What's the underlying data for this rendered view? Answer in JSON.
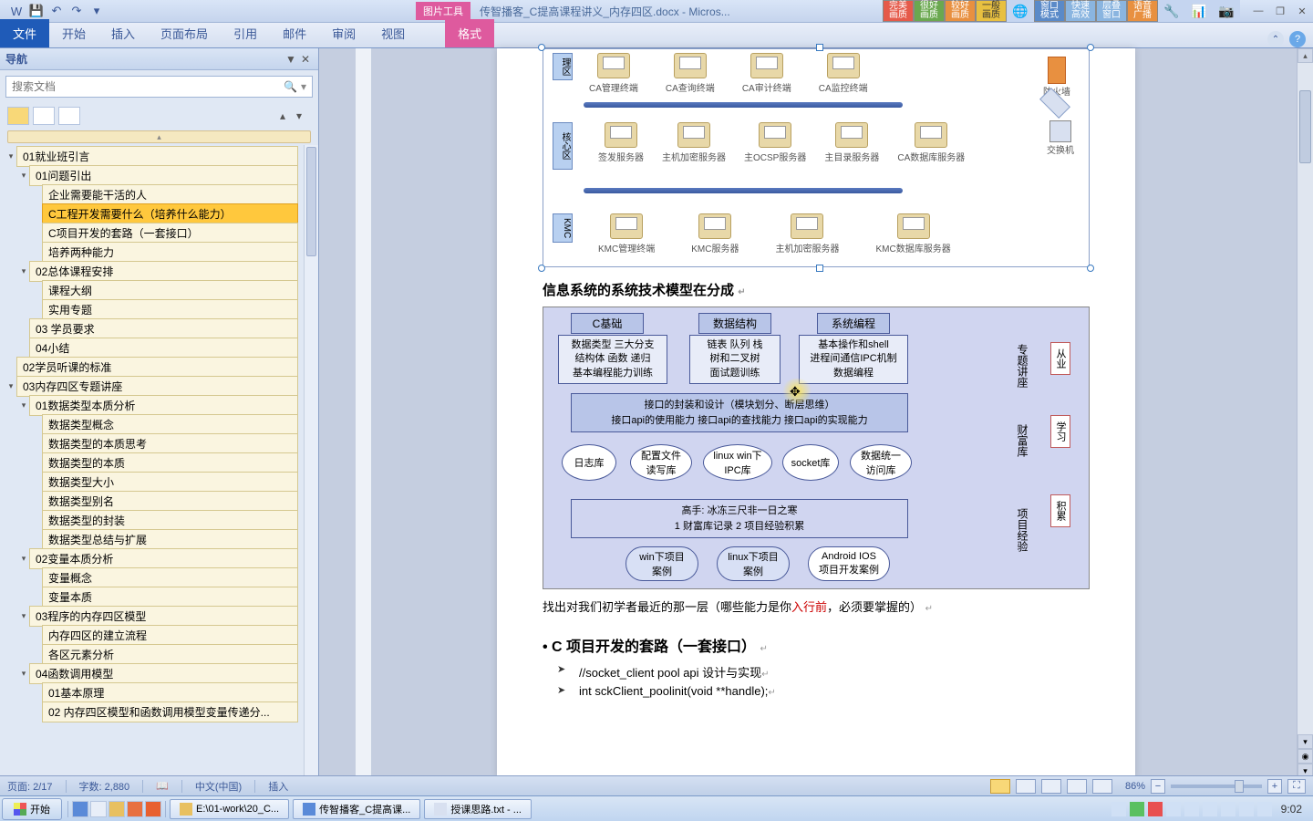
{
  "titlebar": {
    "pic_tools": "图片工具",
    "doc_title": "传智播客_C提高课程讲义_内存四区.docx - Micros...",
    "badges": [
      "完美\n画质",
      "很好\n画质",
      "较好\n画质",
      "一般\n画质",
      "",
      "窗口\n模式",
      "快速\n高效",
      "层叠\n窗口",
      "语音\n广播"
    ]
  },
  "ribbon": {
    "tabs": [
      "文件",
      "开始",
      "插入",
      "页面布局",
      "引用",
      "邮件",
      "审阅",
      "视图"
    ],
    "format_tab": "格式"
  },
  "nav": {
    "title": "导航",
    "search_placeholder": "搜索文档",
    "items": [
      {
        "level": 1,
        "caret": "▾",
        "text": "01就业班引言"
      },
      {
        "level": 2,
        "caret": "▾",
        "text": "01问题引出"
      },
      {
        "level": 3,
        "caret": "",
        "text": "企业需要能干活的人"
      },
      {
        "level": 3,
        "caret": "",
        "text": "C工程开发需要什么（培养什么能力）",
        "selected": true
      },
      {
        "level": 3,
        "caret": "",
        "text": "C项目开发的套路（一套接口）"
      },
      {
        "level": 3,
        "caret": "",
        "text": "培养两种能力"
      },
      {
        "level": 2,
        "caret": "▾",
        "text": "02总体课程安排"
      },
      {
        "level": 3,
        "caret": "",
        "text": "课程大纲"
      },
      {
        "level": 3,
        "caret": "",
        "text": "实用专题"
      },
      {
        "level": 2,
        "caret": "",
        "text": "03 学员要求"
      },
      {
        "level": 2,
        "caret": "",
        "text": "04小结"
      },
      {
        "level": 1,
        "caret": "",
        "text": "02学员听课的标准"
      },
      {
        "level": 1,
        "caret": "▾",
        "text": "03内存四区专题讲座"
      },
      {
        "level": 2,
        "caret": "▾",
        "text": "01数据类型本质分析"
      },
      {
        "level": 3,
        "caret": "",
        "text": "数据类型概念"
      },
      {
        "level": 3,
        "caret": "",
        "text": "数据类型的本质思考"
      },
      {
        "level": 3,
        "caret": "",
        "text": "数据类型的本质"
      },
      {
        "level": 3,
        "caret": "",
        "text": "数据类型大小"
      },
      {
        "level": 3,
        "caret": "",
        "text": "数据类型别名"
      },
      {
        "level": 3,
        "caret": "",
        "text": "数据类型的封装"
      },
      {
        "level": 3,
        "caret": "",
        "text": "数据类型总结与扩展"
      },
      {
        "level": 2,
        "caret": "▾",
        "text": "02变量本质分析"
      },
      {
        "level": 3,
        "caret": "",
        "text": "变量概念"
      },
      {
        "level": 3,
        "caret": "",
        "text": "变量本质"
      },
      {
        "level": 2,
        "caret": "▾",
        "text": "03程序的内存四区模型"
      },
      {
        "level": 3,
        "caret": "",
        "text": "内存四区的建立流程"
      },
      {
        "level": 3,
        "caret": "",
        "text": "各区元素分析"
      },
      {
        "level": 2,
        "caret": "▾",
        "text": "04函数调用模型"
      },
      {
        "level": 3,
        "caret": "",
        "text": "01基本原理"
      },
      {
        "level": 3,
        "caret": "",
        "text": "02 内存四区模型和函数调用模型变量传递分..."
      }
    ]
  },
  "diagram1": {
    "zones": [
      "理区",
      "核心区",
      "KMC"
    ],
    "row1": [
      "CA管理终端",
      "CA查询终端",
      "CA审计终端",
      "CA监控终端"
    ],
    "row1_right": "防火墙",
    "row2": [
      "签发服务器",
      "主机加密服务器",
      "主OCSP服务器",
      "主目录服务器",
      "CA数据库服务器"
    ],
    "row2_right": "交换机",
    "row3": [
      "KMC管理终端",
      "KMC服务器",
      "主机加密服务器",
      "KMC数据库服务器"
    ]
  },
  "heading1": "信息系统的系统技术模型在分成",
  "diagram2": {
    "top": [
      "C基础",
      "数据结构",
      "系统编程"
    ],
    "box1": "数据类型 三大分支\n结构体 函数 递归\n基本编程能力训练",
    "box2": "链表 队列 栈\n树和二叉树\n面试题训练",
    "box3": "基本操作和shell\n进程间通信IPC机制\n数据编程",
    "side1": "专题讲座",
    "side2": "财富库",
    "side3": "项目经验",
    "pentagon1": "从业",
    "pentagon2": "学习",
    "pentagon3": "积累",
    "arrow1_l1": "接口的封装和设计（模块划分、断层思维）",
    "arrow1_l2": "接口api的使用能力 接口api的查找能力 接口api的实现能力",
    "ovals": [
      "日志库",
      "配置文件\n读写库",
      "linux win下\nIPC库",
      "socket库",
      "数据统一\n访问库"
    ],
    "arrow2_l1": "高手: 冰冻三尺非一日之寒",
    "arrow2_l2": "1 财富库记录 2 项目经验积累",
    "bottom_ovals": [
      "win下项目\n案例",
      "linux下项目\n案例",
      "Android IOS\n项目开发案例"
    ]
  },
  "body_text_1_pre": "找出对我们初学者最近的那一层（哪些能力是你",
  "body_text_1_red": "入行前",
  "body_text_1_post": "，必须要掌握的）",
  "bullet_heading": "• C 项目开发的套路（一套接口）",
  "bullets": [
    {
      "pre": "//",
      "ul": "socket_client",
      "post": " pool api  设计与实现"
    },
    {
      "pre": "int ",
      "ul": "sckClient_poolinit",
      "post": "(void **handle);"
    }
  ],
  "status": {
    "page": "页面: 2/17",
    "words": "字数: 2,880",
    "lang": "中文(中国)",
    "mode": "插入",
    "zoom": "86%"
  },
  "taskbar": {
    "start": "开始",
    "tasks": [
      "E:\\01-work\\20_C...",
      "传智播客_C提高课...",
      "授课思路.txt - ..."
    ],
    "clock": "9:02"
  }
}
